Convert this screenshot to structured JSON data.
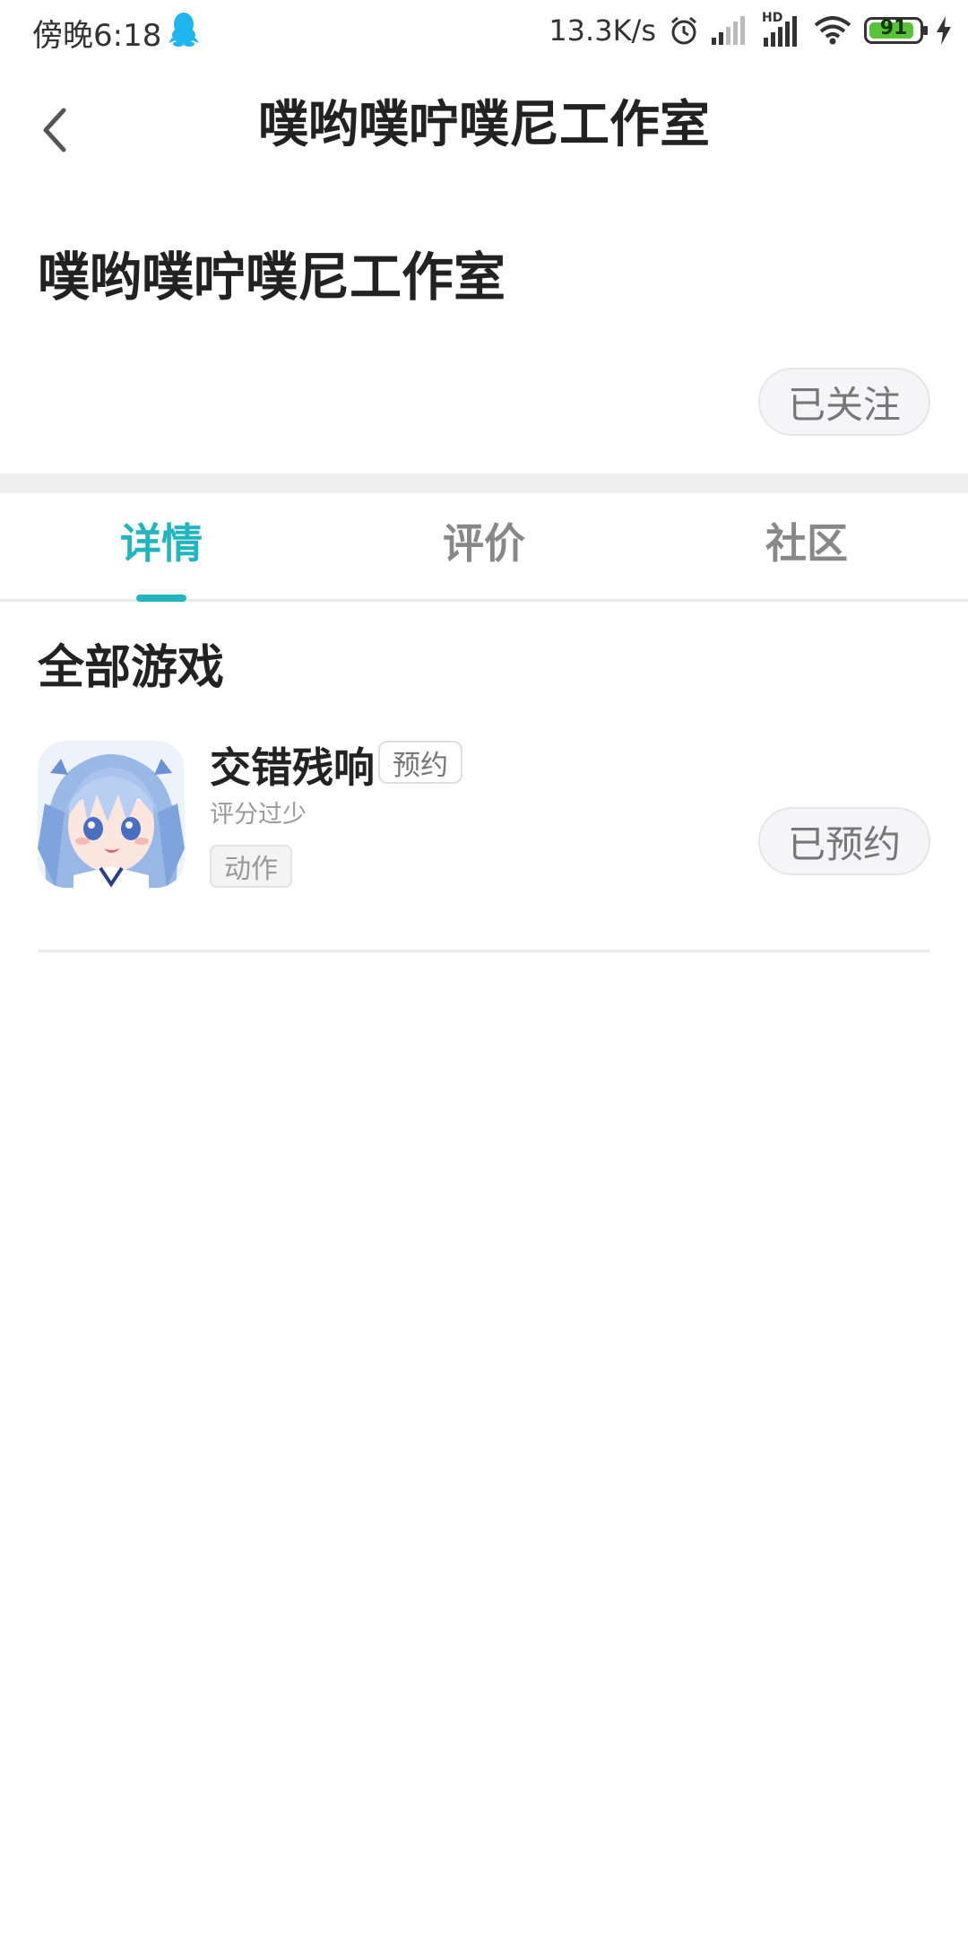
{
  "status_bar": {
    "time": "傍晚6:18",
    "net_speed": "13.3K/s",
    "network_label": "HD",
    "battery_level": 91,
    "battery_text": "91",
    "battery_color": "#59c337",
    "icons": [
      "qq-icon",
      "alarm-icon",
      "signal-icon",
      "signal-hd-icon",
      "wifi-icon",
      "battery-icon",
      "charging-icon"
    ]
  },
  "header": {
    "back_icon": "back-arrow-icon",
    "title": "噗哟噗咛噗尼工作室"
  },
  "studio": {
    "name": "噗哟噗咛噗尼工作室",
    "follow_label": "已关注"
  },
  "tabs": [
    {
      "label": "详情",
      "active": true
    },
    {
      "label": "评价",
      "active": false
    },
    {
      "label": "社区",
      "active": false
    }
  ],
  "accent_color": "#22b5bf",
  "section_title": "全部游戏",
  "games": [
    {
      "name": "交错残响",
      "status_tag": "预约",
      "rating_text": "评分过少",
      "genre_tag": "动作",
      "action_label": "已预约",
      "icon": "anime-girl-game-icon"
    }
  ]
}
